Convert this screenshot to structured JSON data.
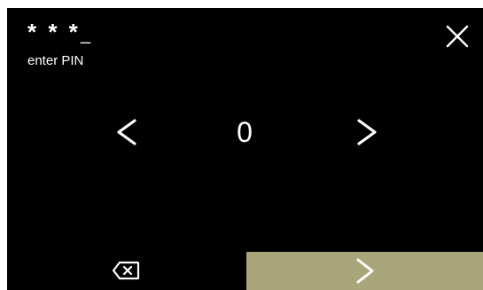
{
  "pin": {
    "masked": "* * *",
    "cursor": "_",
    "label": "enter PIN"
  },
  "selector": {
    "current_digit": "0"
  },
  "icons": {
    "close": "close-icon",
    "previous": "chevron-left-icon",
    "next": "chevron-right-icon",
    "backspace": "backspace-icon",
    "confirm": "chevron-right-icon"
  },
  "colors": {
    "background": "#000000",
    "foreground": "#ffffff",
    "confirm_button": "#a9a67a"
  }
}
